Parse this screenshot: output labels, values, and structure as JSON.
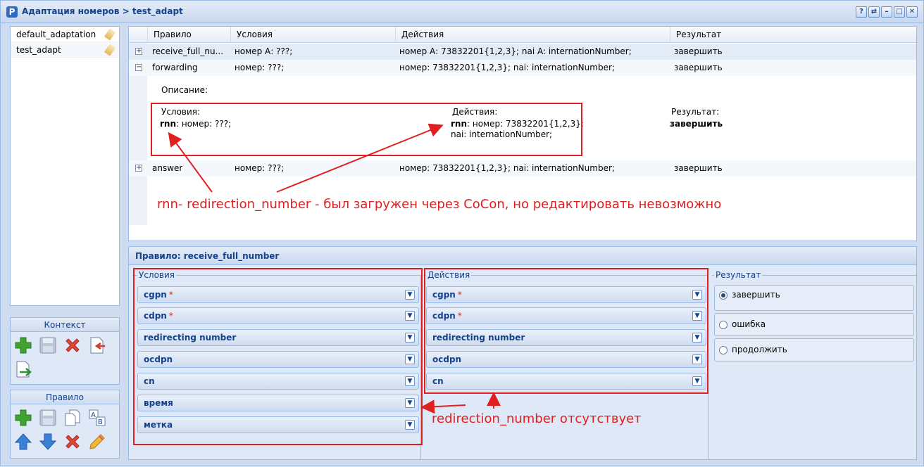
{
  "window": {
    "title": "Адаптация номеров > test_adapt"
  },
  "titlebar_buttons": [
    "?",
    "⇄",
    "–",
    "□",
    "✕"
  ],
  "adaptations": [
    {
      "label": "default_adaptation"
    },
    {
      "label": "test_adapt"
    }
  ],
  "context_panel": {
    "title": "Контекст"
  },
  "rule_panel": {
    "title": "Правило"
  },
  "grid": {
    "columns": [
      "Правило",
      "Условия",
      "Действия",
      "Результат"
    ],
    "rows": [
      {
        "expander": "+",
        "rule": "receive_full_nu...",
        "conditions": "номер А: ???;",
        "actions": "номер А: 73832201{1,2,3}; nai A: internationNumber;",
        "result": "завершить"
      },
      {
        "expander": "−",
        "rule": "forwarding",
        "conditions": "номер: ???;",
        "actions": "номер: 73832201{1,2,3}; nai: internationNumber;",
        "result": "завершить"
      },
      {
        "expander": "+",
        "rule": "answer",
        "conditions": "номер: ???;",
        "actions": "номер: 73832201{1,2,3}; nai: internationNumber;",
        "result": "завершить"
      }
    ],
    "detail": {
      "description_label": "Описание:",
      "conditions_label": "Условия:",
      "conditions_key": "rnn",
      "conditions_value": ": номер: ???;",
      "actions_label": "Действия:",
      "actions_key": "rnn",
      "actions_value": ": номер: 73832201{1,2,3};",
      "actions_value2": "nai: internationNumber;",
      "result_label": "Результат:",
      "result_value": "завершить"
    }
  },
  "annotations": {
    "top_note": "rnn- redirection_number - был загружен через CoCon, но редактировать невозможно",
    "bottom_note": "redirection_number отсутствует"
  },
  "editor": {
    "title": "Правило: receive_full_number",
    "conditions_label": "Условия",
    "actions_label": "Действия",
    "result_label": "Результат",
    "conditions_fields": [
      {
        "label": "cgpn",
        "required": "*"
      },
      {
        "label": "cdpn",
        "required": "*"
      },
      {
        "label": "redirecting number",
        "required": ""
      },
      {
        "label": "ocdpn",
        "required": ""
      },
      {
        "label": "cn",
        "required": ""
      },
      {
        "label": "время",
        "required": ""
      },
      {
        "label": "метка",
        "required": ""
      }
    ],
    "actions_fields": [
      {
        "label": "cgpn",
        "required": "*"
      },
      {
        "label": "cdpn",
        "required": "*"
      },
      {
        "label": "redirecting number",
        "required": ""
      },
      {
        "label": "ocdpn",
        "required": ""
      },
      {
        "label": "cn",
        "required": ""
      }
    ],
    "result_options": [
      {
        "label": "завершить",
        "selected": true
      },
      {
        "label": "ошибка",
        "selected": false
      },
      {
        "label": "продолжить",
        "selected": false
      }
    ]
  },
  "colors": {
    "accent": "#15428b",
    "annotation": "#e02020",
    "panel": "#dfe8f6",
    "border": "#99bbe8"
  }
}
